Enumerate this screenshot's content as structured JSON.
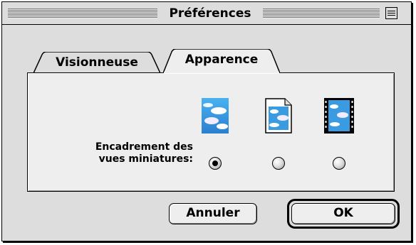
{
  "window": {
    "title": "Préférences"
  },
  "tabs": [
    {
      "label": "Visionneuse",
      "selected": false
    },
    {
      "label": "Apparence",
      "selected": true
    }
  ],
  "thumbnail_frame": {
    "label_line1": "Encadrement des",
    "label_line2": "vues miniatures:",
    "options": [
      {
        "icon": "thumbnail-plain-icon",
        "selected": true
      },
      {
        "icon": "thumbnail-document-icon",
        "selected": false
      },
      {
        "icon": "thumbnail-filmstrip-icon",
        "selected": false
      }
    ]
  },
  "buttons": {
    "cancel": "Annuler",
    "ok": "OK"
  },
  "colors": {
    "window_bg": "#dddddd",
    "panel_bg": "#eeeeee",
    "sky": "#3a9be0"
  }
}
